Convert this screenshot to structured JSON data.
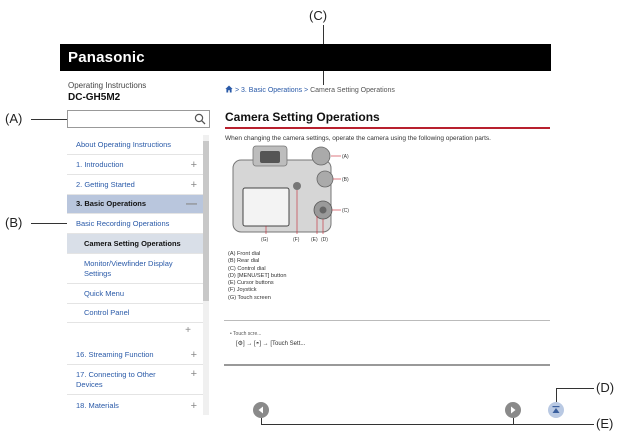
{
  "callouts": {
    "a": "(A)",
    "b": "(B)",
    "c": "(C)",
    "d": "(D)",
    "e": "(E)"
  },
  "header": {
    "brand": "Panasonic"
  },
  "doc": {
    "type": "Operating Instructions",
    "model": "DC-GH5M2"
  },
  "search": {
    "placeholder": "",
    "icon": "search-icon"
  },
  "sidebar": {
    "items": [
      {
        "label": "About Operating Instructions",
        "expander": ""
      },
      {
        "label": "1. Introduction",
        "expander": "+"
      },
      {
        "label": "2. Getting Started",
        "expander": "+"
      },
      {
        "label": "3. Basic Operations",
        "expander": "—"
      },
      {
        "label": "Basic Recording Operations",
        "expander": ""
      },
      {
        "label": "Camera Setting Operations",
        "expander": ""
      },
      {
        "label": "Monitor/Viewfinder Display Settings",
        "expander": ""
      },
      {
        "label": "Quick Menu",
        "expander": ""
      },
      {
        "label": "Control Panel",
        "expander": ""
      },
      {
        "label": "16. Streaming Function",
        "expander": "+"
      },
      {
        "label": "17. Connecting to Other Devices",
        "expander": "+"
      },
      {
        "label": "18. Materials",
        "expander": "+"
      }
    ]
  },
  "breadcrumb": {
    "home_icon": "home-icon",
    "parent": "3. Basic Operations",
    "separator": ">",
    "current": "Camera Setting Operations"
  },
  "main": {
    "title": "Camera Setting Operations",
    "intro": "When changing the camera settings, operate the camera using the following operation parts.",
    "figure_labels": {
      "a": "(A)",
      "b": "(B)",
      "c": "(C)",
      "d": "(D)",
      "e": "(E)",
      "f": "(F)",
      "g": "(G)"
    },
    "legend": [
      "(A) Front dial",
      "(B) Rear dial",
      "(C) Control dial",
      "(D) [MENU/SET] button",
      "(E) Cursor buttons",
      "(F) Joystick",
      "(G) Touch screen"
    ],
    "snippet_line1": "• Touch scre...",
    "snippet_line2": "[⚙] → [◓] → [Touch Sett..."
  },
  "colors": {
    "accent": "#b8202e",
    "link": "#2a5aa8",
    "active_bg": "#b9c6dd"
  }
}
